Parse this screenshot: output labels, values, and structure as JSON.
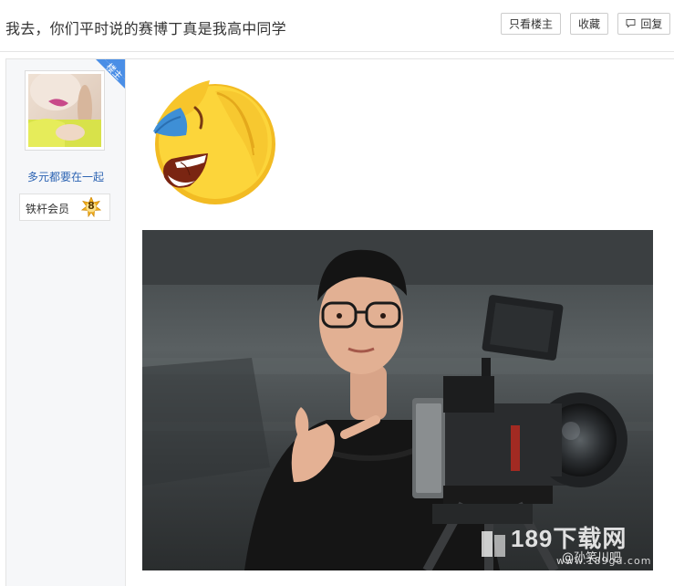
{
  "thread": {
    "title": "我去，你们平时说的赛博丁真是我高中同学"
  },
  "toolbar": {
    "only_op_label": "只看楼主",
    "favorite_label": "收藏",
    "reply_label": "回复"
  },
  "post": {
    "op_badge": "楼主",
    "author": {
      "name": "多元都要在一起",
      "level_title": "铁杆会员",
      "level": "8"
    }
  },
  "watermark": {
    "site_text": "189下载网",
    "site_url": "www.189gd.com",
    "handle": "@孙笑川吧"
  },
  "colors": {
    "link_blue": "#2d64b3",
    "badge_blue": "#4a8ee6",
    "level_gold": "#f2b21f"
  }
}
